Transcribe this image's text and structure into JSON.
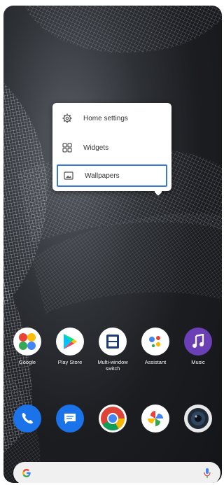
{
  "popup_menu": {
    "items": [
      {
        "label": "Home settings",
        "icon": "gear-icon"
      },
      {
        "label": "Widgets",
        "icon": "widgets-icon"
      },
      {
        "label": "Wallpapers",
        "icon": "wallpaper-icon",
        "selected": true
      }
    ]
  },
  "apps": [
    {
      "label": "Google",
      "icon": "google-folder-icon"
    },
    {
      "label": "Play Store",
      "icon": "play-store-icon"
    },
    {
      "label": "Multi-window switch",
      "icon": "multi-window-icon"
    },
    {
      "label": "Assistant",
      "icon": "assistant-icon"
    },
    {
      "label": "Music",
      "icon": "music-icon",
      "color": "#6b3fb5"
    }
  ],
  "dock": [
    {
      "icon": "phone-icon",
      "color": "#1a73e8"
    },
    {
      "icon": "messages-icon",
      "color": "#1a73e8"
    },
    {
      "icon": "chrome-icon"
    },
    {
      "icon": "photos-icon"
    },
    {
      "icon": "camera-icon"
    }
  ],
  "search_bar": {
    "icon": "google-g-icon",
    "mic_icon": "mic-icon"
  }
}
